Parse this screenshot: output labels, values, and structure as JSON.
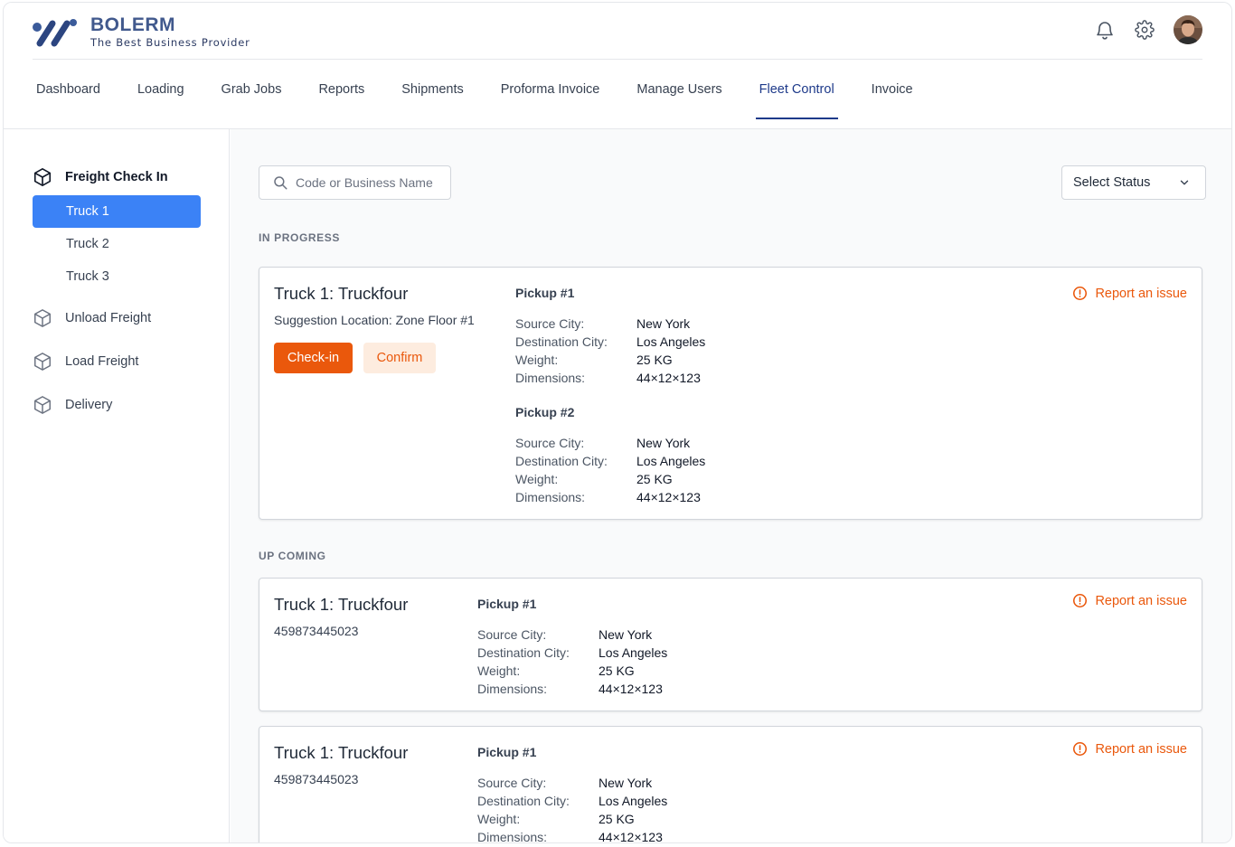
{
  "brand": {
    "name": "BOLERM",
    "tagline": "The Best Business Provider"
  },
  "header_icons": [
    "bell-icon",
    "gear-icon",
    "user-avatar"
  ],
  "nav": [
    {
      "label": "Dashboard"
    },
    {
      "label": "Loading"
    },
    {
      "label": "Grab Jobs"
    },
    {
      "label": "Reports"
    },
    {
      "label": "Shipments"
    },
    {
      "label": "Proforma Invoice"
    },
    {
      "label": "Manage Users"
    },
    {
      "label": "Fleet Control",
      "active": true
    },
    {
      "label": "Invoice"
    }
  ],
  "sidebar": {
    "freight_check_in": "Freight Check In",
    "trucks": [
      "Truck 1",
      "Truck 2",
      "Truck 3"
    ],
    "active_truck": "Truck 1",
    "unload_freight": "Unload Freight",
    "load_freight": "Load Freight",
    "delivery": "Delivery"
  },
  "search": {
    "placeholder": "Code or Business Name"
  },
  "status_select": {
    "value": "Select Status"
  },
  "sections": {
    "in_progress": "IN PROGRESS",
    "upcoming": "UP COMING"
  },
  "labels": {
    "source_city": "Source City:",
    "destination_city": "Destination City:",
    "weight": "Weight:",
    "dimensions": "Dimensions:",
    "report": "Report an issue",
    "checkin": "Check-in",
    "confirm": "Confirm"
  },
  "in_progress_card": {
    "title": "Truck 1: Truckfour",
    "subtitle": "Suggestion Location: Zone Floor #1",
    "pickups": [
      {
        "title": "Pickup #1",
        "source": "New York",
        "destination": "Los Angeles",
        "weight": "25 KG",
        "dimensions": "44×12×123"
      },
      {
        "title": "Pickup #2",
        "source": "New York",
        "destination": "Los Angeles",
        "weight": "25 KG",
        "dimensions": "44×12×123"
      }
    ]
  },
  "upcoming_cards": [
    {
      "title": "Truck 1: Truckfour",
      "code": "459873445023",
      "pickup": {
        "title": "Pickup #1",
        "source": "New York",
        "destination": "Los Angeles",
        "weight": "25 KG",
        "dimensions": "44×12×123"
      }
    },
    {
      "title": "Truck 1: Truckfour",
      "code": "459873445023",
      "pickup": {
        "title": "Pickup #1",
        "source": "New York",
        "destination": "Los Angeles",
        "weight": "25 KG",
        "dimensions": "44×12×123"
      }
    }
  ],
  "colors": {
    "accent": "#ea580c",
    "active_nav": "#1e3a8a",
    "active_side": "#3b82f6",
    "brand": "#41598d"
  }
}
